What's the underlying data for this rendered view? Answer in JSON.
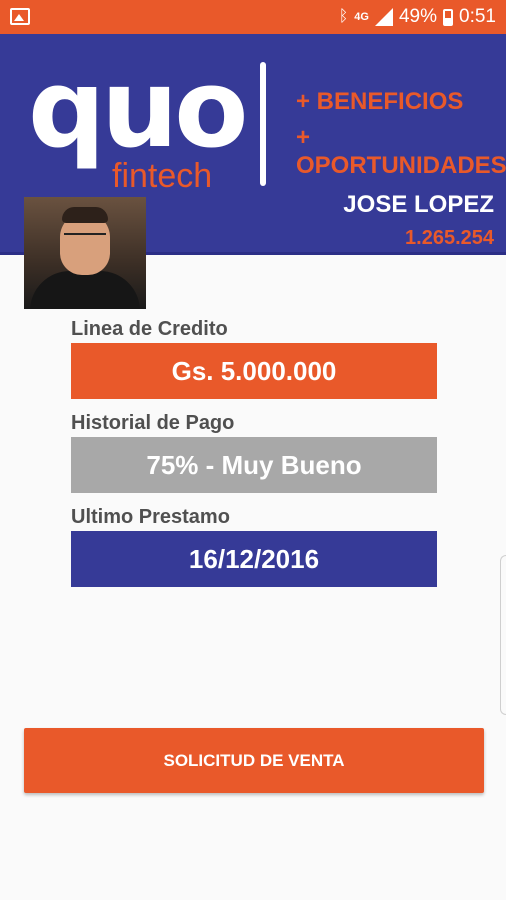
{
  "status_bar": {
    "battery": "49%",
    "time": "0:51",
    "icons": [
      "gallery-icon",
      "bluetooth-icon",
      "data-4g-icon",
      "signal-icon",
      "battery-icon"
    ]
  },
  "header": {
    "logo_main": "quo",
    "logo_sub": "fintech",
    "tagline_1": "+ BENEFICIOS",
    "tagline_2": "+ OPORTUNIDADES",
    "user_name": "JOSE LOPEZ",
    "user_id": "1.265.254"
  },
  "credit_line": {
    "label": "Linea de Credito",
    "value": "Gs. 5.000.000"
  },
  "payment_history": {
    "label": "Historial de Pago",
    "value": "75% - Muy Bueno"
  },
  "last_loan": {
    "label": "Ultimo Prestamo",
    "value": "16/12/2016"
  },
  "action_button": {
    "label": "SOLICITUD DE VENTA"
  },
  "colors": {
    "accent_orange": "#e9592a",
    "brand_navy": "#363a97",
    "neutral_gray": "#a8a8a8"
  }
}
